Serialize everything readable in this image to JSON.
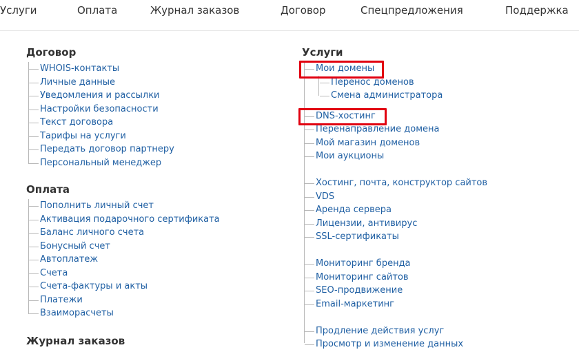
{
  "topnav": {
    "items": [
      "Услуги",
      "Оплата",
      "Журнал заказов",
      "Договор",
      "Спецпредложения",
      "Поддержка"
    ]
  },
  "left": {
    "dogovor": {
      "title": "Договор",
      "items": [
        "WHOIS-контакты",
        "Личные данные",
        "Уведомления и рассылки",
        "Настройки безопасности",
        "Текст договора",
        "Тарифы на услуги",
        "Передать договор партнеру",
        "Персональный менеджер"
      ]
    },
    "oplata": {
      "title": "Оплата",
      "items": [
        "Пополнить личный счет",
        "Активация подарочного сертификата",
        "Баланс личного счета",
        "Бонусный счет",
        "Автоплатеж",
        "Счета",
        "Счета-фактуры и акты",
        "Платежи",
        "Взаиморасчеты"
      ]
    },
    "zhurnal": {
      "title": "Журнал заказов"
    }
  },
  "right": {
    "uslugi": {
      "title": "Услуги",
      "moi_domeny": "Мои домены",
      "moi_domeny_sub": [
        "Перенос доменов",
        "Смена администратора"
      ],
      "group1": [
        "DNS-хостинг",
        "Перенаправление домена",
        "Мой магазин доменов",
        "Мои аукционы"
      ],
      "group2": [
        "Хостинг, почта, конструктор сайтов",
        "VDS",
        "Аренда сервера",
        "Лицензии, антивирус",
        "SSL-сертификаты"
      ],
      "group3": [
        "Мониторинг бренда",
        "Мониторинг сайтов",
        "SEO-продвижение",
        "Email-маркетинг"
      ],
      "group4": [
        "Продление действия услуг",
        "Просмотр и изменение данных"
      ]
    }
  },
  "colors": {
    "link": "#1f5fa3",
    "highlight": "#e1000f",
    "text": "#333333"
  }
}
